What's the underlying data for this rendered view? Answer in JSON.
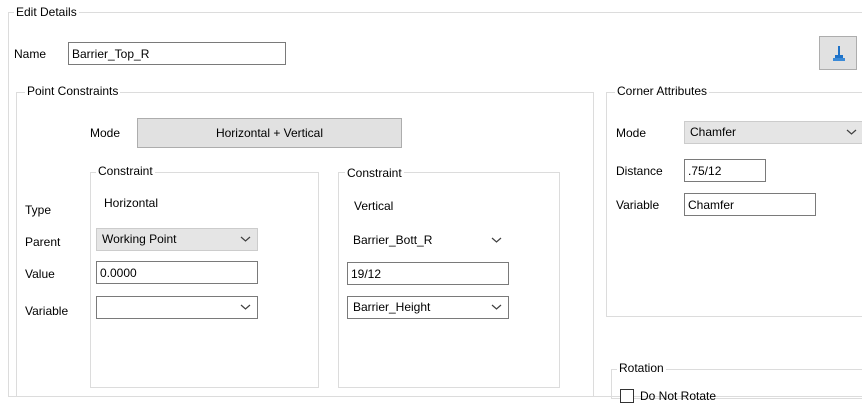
{
  "edit_details": {
    "title": "Edit Details",
    "name_label": "Name",
    "name_value": "Barrier_Top_R"
  },
  "point_constraints": {
    "title": "Point Constraints",
    "mode_label": "Mode",
    "mode_value": "Horizontal + Vertical",
    "row_labels": {
      "type": "Type",
      "parent": "Parent",
      "value": "Value",
      "variable": "Variable"
    },
    "constraint1": {
      "title": "Constraint",
      "type": "Horizontal",
      "parent": "Working Point",
      "value": "0.0000",
      "variable": ""
    },
    "constraint2": {
      "title": "Constraint",
      "type": "Vertical",
      "parent": "Barrier_Bott_R",
      "value": "19/12",
      "variable": "Barrier_Height"
    }
  },
  "corner_attributes": {
    "title": "Corner Attributes",
    "mode_label": "Mode",
    "mode_value": "Chamfer",
    "distance_label": "Distance",
    "distance_value": ".75/12",
    "variable_label": "Variable",
    "variable_value": "Chamfer"
  },
  "rotation": {
    "title": "Rotation",
    "do_not_rotate_label": "Do Not Rotate",
    "do_not_rotate_checked": false
  },
  "icons": {
    "clear_button": "brush-icon",
    "dropdown": "chevron-down-icon"
  },
  "colors": {
    "accent": "#1e72c8",
    "group_border": "#dcdcdc",
    "button_face": "#e1e1e1"
  }
}
